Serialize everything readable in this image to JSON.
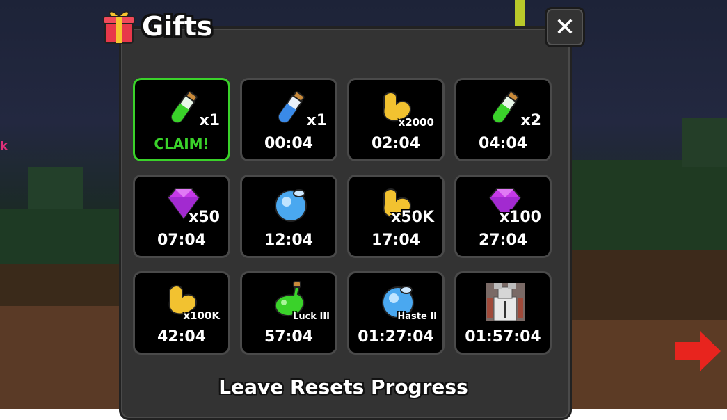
{
  "window": {
    "title": "Gifts"
  },
  "close_label": "✕",
  "tiles": [
    {
      "icon": "green-potion-icon",
      "qty": "x1",
      "time": "CLAIM!",
      "claim": true
    },
    {
      "icon": "blue-potion-icon",
      "qty": "x1",
      "time": "00:04"
    },
    {
      "icon": "strength-arm-icon",
      "qty": "x2000",
      "time": "02:04"
    },
    {
      "icon": "green-potion-icon",
      "qty": "x2",
      "time": "04:04"
    },
    {
      "icon": "purple-gem-icon",
      "qty": "x50",
      "time": "07:04"
    },
    {
      "icon": "blue-orb-icon",
      "qty": "",
      "time": "12:04"
    },
    {
      "icon": "strength-arm-icon",
      "qty": "x50K",
      "time": "17:04"
    },
    {
      "icon": "purple-gem-icon",
      "qty": "x100",
      "time": "27:04"
    },
    {
      "icon": "strength-arm-icon",
      "qty": "x100K",
      "time": "42:04"
    },
    {
      "icon": "luck-potion-icon",
      "qty": "Luck III",
      "time": "57:04"
    },
    {
      "icon": "haste-orb-icon",
      "qty": "Haste II",
      "time": "01:27:04"
    },
    {
      "icon": "avatar-pet-icon",
      "qty": "",
      "time": "01:57:04"
    }
  ],
  "footer": "Leave Resets Progress",
  "side_text": "k",
  "colors": {
    "claim": "#3ad22a",
    "panel": "#333333",
    "tile": "#000000"
  }
}
